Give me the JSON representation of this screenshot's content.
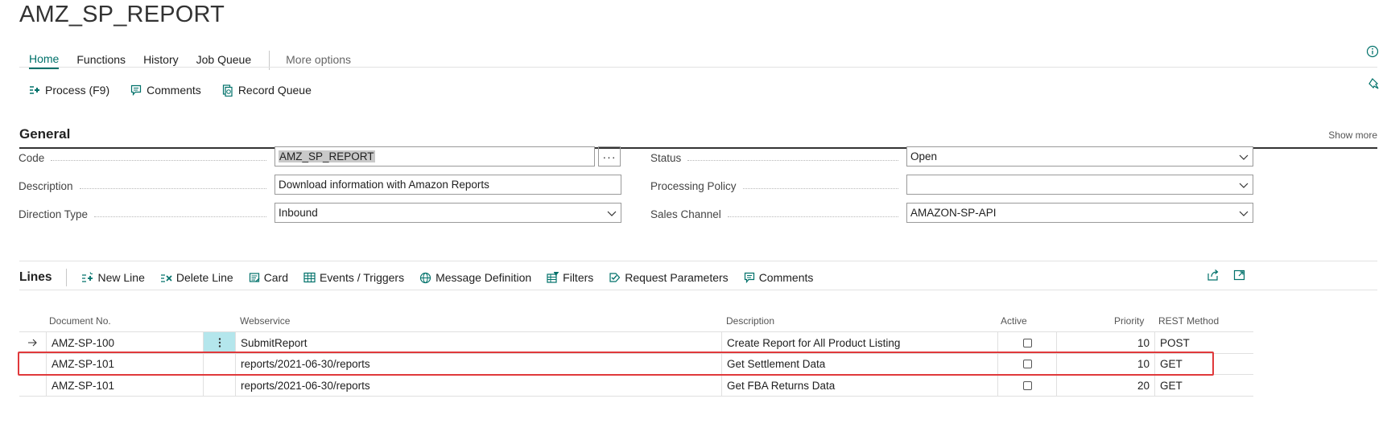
{
  "page": {
    "title": "AMZ_SP_REPORT"
  },
  "tabs": [
    {
      "label": "Home",
      "active": true
    },
    {
      "label": "Functions"
    },
    {
      "label": "History"
    },
    {
      "label": "Job Queue"
    },
    {
      "label": "More options"
    }
  ],
  "actions": {
    "process": "Process (F9)",
    "comments": "Comments",
    "record_queue": "Record Queue"
  },
  "general": {
    "title": "General",
    "show_more": "Show more",
    "code": {
      "label": "Code",
      "value": "AMZ_SP_REPORT"
    },
    "description": {
      "label": "Description",
      "value": "Download information with Amazon Reports"
    },
    "direction_type": {
      "label": "Direction Type",
      "value": "Inbound"
    },
    "status": {
      "label": "Status",
      "value": "Open"
    },
    "processing_policy": {
      "label": "Processing Policy",
      "value": ""
    },
    "sales_channel": {
      "label": "Sales Channel",
      "value": "AMAZON-SP-API"
    }
  },
  "lines": {
    "title": "Lines",
    "actions": {
      "new_line": "New Line",
      "delete_line": "Delete Line",
      "card": "Card",
      "events": "Events / Triggers",
      "message_definition": "Message Definition",
      "filters": "Filters",
      "request_parameters": "Request Parameters",
      "comments": "Comments"
    },
    "columns": {
      "document_no": "Document No.",
      "webservice": "Webservice",
      "description": "Description",
      "active": "Active",
      "priority": "Priority",
      "rest_method": "REST Method"
    },
    "rows": [
      {
        "document_no": "AMZ-SP-100",
        "webservice": "SubmitReport",
        "description": "Create Report for All Product Listing",
        "active": false,
        "priority": "10",
        "rest_method": "POST"
      },
      {
        "document_no": "AMZ-SP-101",
        "webservice": "reports/2021-06-30/reports",
        "description": "Get Settlement Data",
        "active": false,
        "priority": "10",
        "rest_method": "GET"
      },
      {
        "document_no": "AMZ-SP-101",
        "webservice": "reports/2021-06-30/reports",
        "description": "Get FBA Returns Data",
        "active": false,
        "priority": "20",
        "rest_method": "GET"
      }
    ]
  },
  "colors": {
    "accent": "#00716a",
    "highlight_border": "#e0393b",
    "row_menu_bg": "#b4e6ec"
  },
  "icons": {
    "row_indicator": "arrow-right-icon",
    "row_menu": "vertical-ellipsis-icon"
  }
}
